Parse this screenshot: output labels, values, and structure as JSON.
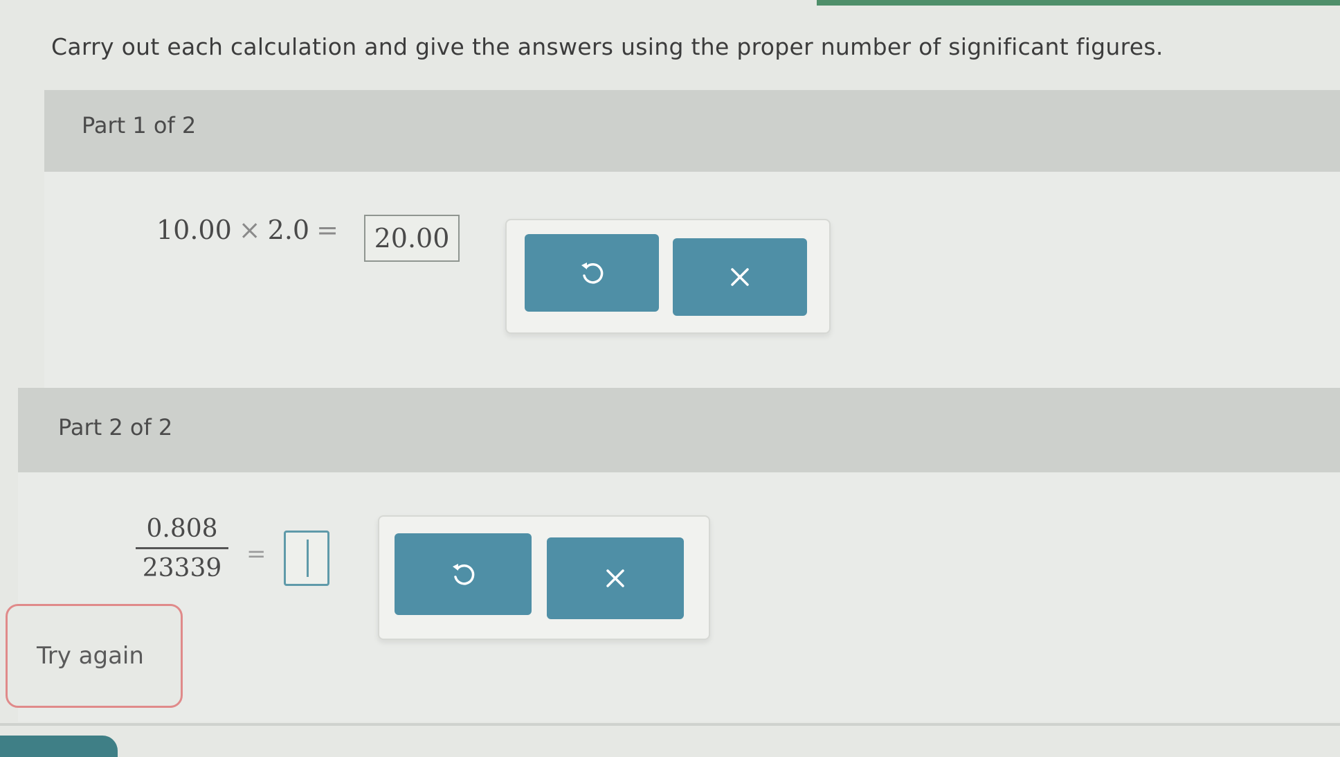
{
  "instructions": "Carry out each calculation and give the answers using the proper number of significant figures.",
  "parts": [
    {
      "title": "Part 1 of 2",
      "expression": {
        "left_operand": "10.00",
        "operator": "×",
        "right_operand": "2.0",
        "equals": "="
      },
      "answer": "20.00",
      "buttons": {
        "undo_icon": "undo-icon",
        "clear_icon": "clear-x-icon",
        "clear_symbol": "×"
      }
    },
    {
      "title": "Part 2 of 2",
      "expression": {
        "numerator": "0.808",
        "denominator": "23339",
        "equals": "="
      },
      "answer": "",
      "buttons": {
        "undo_icon": "undo-icon",
        "clear_icon": "clear-x-icon",
        "clear_symbol": "×"
      }
    }
  ],
  "feedback": {
    "label": "Try again"
  },
  "colors": {
    "button": "#4f8fa6",
    "accent_green": "#4f8f6a",
    "feedback_border": "#e08a8a",
    "input_focus": "#5f9aa9"
  }
}
